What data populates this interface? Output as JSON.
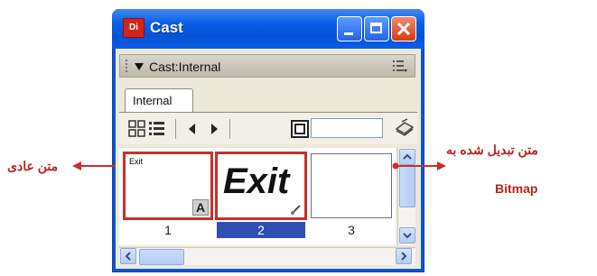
{
  "window": {
    "app_icon_text": "Di",
    "title": "Cast"
  },
  "panel": {
    "title": "Cast:Internal"
  },
  "tabs": [
    {
      "label": "Internal",
      "selected": true
    }
  ],
  "cast_members": [
    {
      "number": "1",
      "caption": "Exit",
      "type": "text",
      "badge": "A"
    },
    {
      "number": "2",
      "content_text": "Exit",
      "type": "bitmap",
      "selected": true
    },
    {
      "number": "3",
      "type": "empty"
    }
  ],
  "annotations": {
    "left_label": "متن عادی",
    "right_label_line1": "متن تبدیل شده به",
    "right_label_line2": "Bitmap"
  },
  "colors": {
    "highlight": "#c9302c",
    "annotation": "#b4261f",
    "title_bar": "#0a5ee6",
    "selection": "#2f4fb3"
  },
  "icons": {
    "app": "director-icon",
    "minimize": "minimize-icon",
    "maximize": "maximize-icon",
    "close": "close-icon",
    "collapse": "triangle-down-icon",
    "panel_options": "options-menu-icon",
    "thumbnail_view": "thumbnail-view-icon",
    "list_view": "list-view-icon",
    "prev": "previous-icon",
    "next": "next-icon",
    "member_type": "member-type-icon",
    "script": "script-icon",
    "bitmap_badge": "paint-brush-icon",
    "text_badge": "text-a-icon"
  }
}
